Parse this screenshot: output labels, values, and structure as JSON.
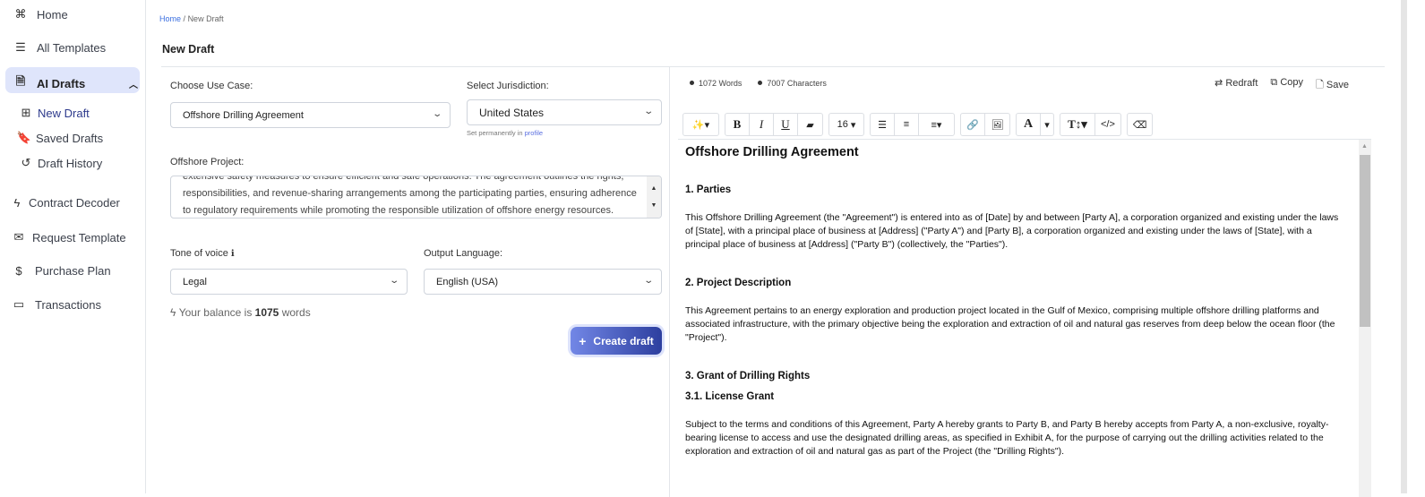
{
  "sidebar": {
    "items": [
      {
        "label": "Home",
        "icon": "command-icon"
      },
      {
        "label": "All Templates",
        "icon": "list-icon"
      },
      {
        "label": "AI Drafts",
        "icon": "document-icon",
        "active": true
      },
      {
        "label": "New Draft",
        "icon": "plus-square-icon"
      },
      {
        "label": "Saved Drafts",
        "icon": "bookmark-icon"
      },
      {
        "label": "Draft History",
        "icon": "history-icon"
      },
      {
        "label": "Contract Decoder",
        "icon": "bolt-icon"
      },
      {
        "label": "Request Template",
        "icon": "mail-icon"
      },
      {
        "label": "Purchase Plan",
        "icon": "dollar-icon"
      },
      {
        "label": "Transactions",
        "icon": "card-icon"
      }
    ]
  },
  "breadcrumb": {
    "home": "Home",
    "sep": "/",
    "current": "New Draft"
  },
  "page_title": "New Draft",
  "form": {
    "use_case_label": "Choose Use Case:",
    "use_case_value": "Offshore Drilling Agreement",
    "jurisdiction_label": "Select Jurisdiction:",
    "jurisdiction_value": "United States",
    "jurisdiction_hint": "Set permanently in ",
    "jurisdiction_hint_link": "profile",
    "project_label": "Offshore Project:",
    "project_text": [
      "extensive safety measures to ensure efficient and safe operations. The agreement outlines the rights,",
      "responsibilities, and revenue-sharing arrangements among the participating parties, ensuring adherence",
      "to regulatory requirements while promoting the responsible utilization of offshore energy resources."
    ],
    "tone_label": "Tone of voice",
    "tone_value": "Legal",
    "language_label": "Output Language:",
    "language_value": "English (USA)",
    "balance_prefix": "Your balance is ",
    "balance_value": "1075",
    "balance_suffix": " words",
    "create_label": "Create draft"
  },
  "editor": {
    "words": "1072 Words",
    "characters": "7007 Characters",
    "redraft": "Redraft",
    "copy": "Copy",
    "save": "Save",
    "font_size": "16",
    "doc": {
      "title": "Offshore Drilling Agreement",
      "sections": [
        {
          "heading": "1. Parties",
          "text": "This Offshore Drilling Agreement (the \"Agreement\") is entered into as of [Date] by and between [Party A], a corporation organized and existing under the laws of [State], with a principal place of business at [Address] (\"Party A\") and [Party B], a corporation organized and existing under the laws of [State], with a principal place of business at [Address] (\"Party B\") (collectively, the \"Parties\")."
        },
        {
          "heading": "2. Project Description",
          "text": "This Agreement pertains to an energy exploration and production project located in the Gulf of Mexico, comprising multiple offshore drilling platforms and associated infrastructure, with the primary objective being the exploration and extraction of oil and natural gas reserves from deep below the ocean floor (the \"Project\")."
        },
        {
          "heading": "3. Grant of Drilling Rights",
          "sub": "3.1. License Grant",
          "text": "Subject to the terms and conditions of this Agreement, Party A hereby grants to Party B, and Party B hereby accepts from Party A, a non-exclusive, royalty-bearing license to access and use the designated drilling areas, as specified in Exhibit A, for the purpose of carrying out the drilling activities related to the exploration and extraction of oil and natural gas as part of the Project (the \"Drilling Rights\")."
        }
      ]
    }
  }
}
